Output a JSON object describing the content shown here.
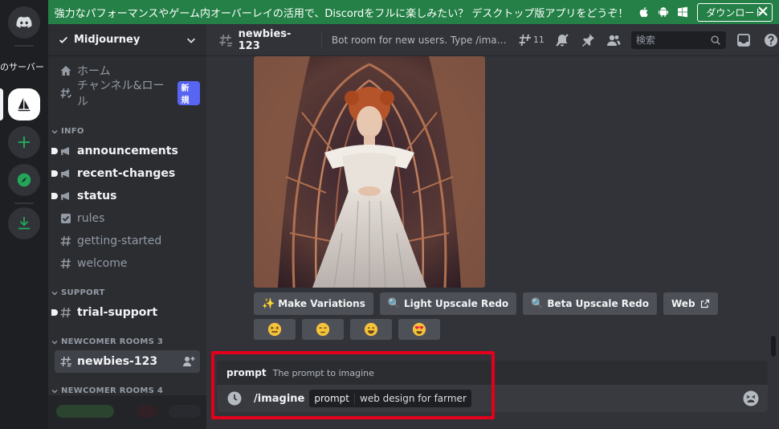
{
  "banner": {
    "message": "強力なパフォーマンスやゲーム内オーバーレイの活用で、Discordをフルに楽しみたい？ デスクトップ版アプリをどうぞ！",
    "download_label": "ダウンロード"
  },
  "rail": {
    "server_text": "のサーバー"
  },
  "server": {
    "name": "Midjourney",
    "home_label": "ホーム",
    "roles_label": "チャンネル&ロール",
    "new_badge": "新規"
  },
  "categories": {
    "info": "INFO",
    "support": "SUPPORT",
    "newcomer3": "NEWCOMER ROOMS 3",
    "newcomer4": "NEWCOMER ROOMS 4"
  },
  "channels": {
    "announcements": "announcements",
    "recent_changes": "recent-changes",
    "status": "status",
    "rules": "rules",
    "getting_started": "getting-started",
    "welcome": "welcome",
    "trial_support": "trial-support",
    "newbies": "newbies-123"
  },
  "header": {
    "channel": "newbies-123",
    "topic": "Bot room for new users. Type /imagine then...",
    "thread_count": "11",
    "search_placeholder": "検索"
  },
  "actions": {
    "make_variations": "Make Variations",
    "light_upscale": "Light Upscale Redo",
    "beta_upscale": "Beta Upscale Redo",
    "web": "Web"
  },
  "command": {
    "option_name": "prompt",
    "option_desc": "The prompt to imagine",
    "name": "/imagine",
    "param_name": "prompt",
    "param_value": "web design for farmer"
  },
  "colors": {
    "banner": "#248046",
    "accent": "#5865f2",
    "highlight": "#e3001b"
  }
}
